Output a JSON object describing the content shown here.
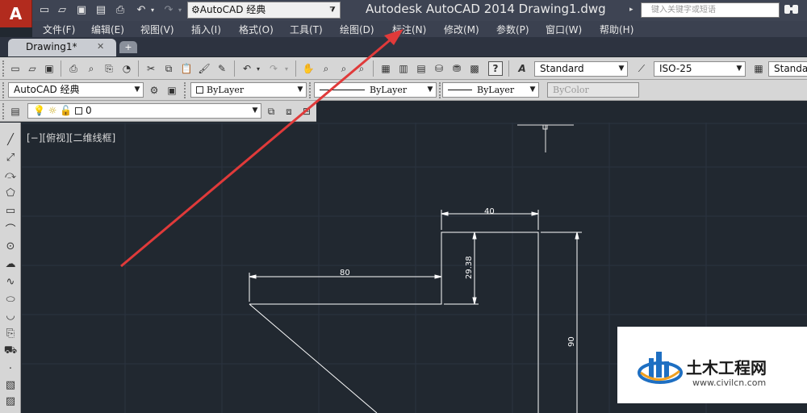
{
  "titlebar": {
    "app_button_label": "A",
    "workspace": "AutoCAD 经典",
    "title": "Autodesk AutoCAD 2014    Drawing1.dwg",
    "search_placeholder": "键入关键字或短语"
  },
  "menu": {
    "items": [
      "文件(F)",
      "编辑(E)",
      "视图(V)",
      "插入(I)",
      "格式(O)",
      "工具(T)",
      "绘图(D)",
      "标注(N)",
      "修改(M)",
      "参数(P)",
      "窗口(W)",
      "帮助(H)"
    ]
  },
  "tabs": {
    "active": "Drawing1*"
  },
  "toolbars": {
    "text_style": "Standard",
    "dim_style": "ISO-25",
    "table_style": "Standard",
    "workspace": "AutoCAD 经典",
    "color": "ByLayer",
    "linetype": "ByLayer",
    "lineweight": "ByLayer",
    "plotstyle": "ByColor",
    "layer": "0"
  },
  "viewport": {
    "label": "[−][俯视][二维线框]"
  },
  "dimensions": {
    "top_width": "40",
    "left_length": "80",
    "vertical_small": "29.38",
    "vertical_large": "90"
  },
  "watermark": {
    "name": "土木工程网",
    "url": "www.civilcn.com"
  },
  "colors": {
    "canvas": "#212830",
    "grid": "#2b3340",
    "geometry": "#ffffff",
    "annotation_arrow": "#e03a3a",
    "app_button": "#b22b1e"
  }
}
